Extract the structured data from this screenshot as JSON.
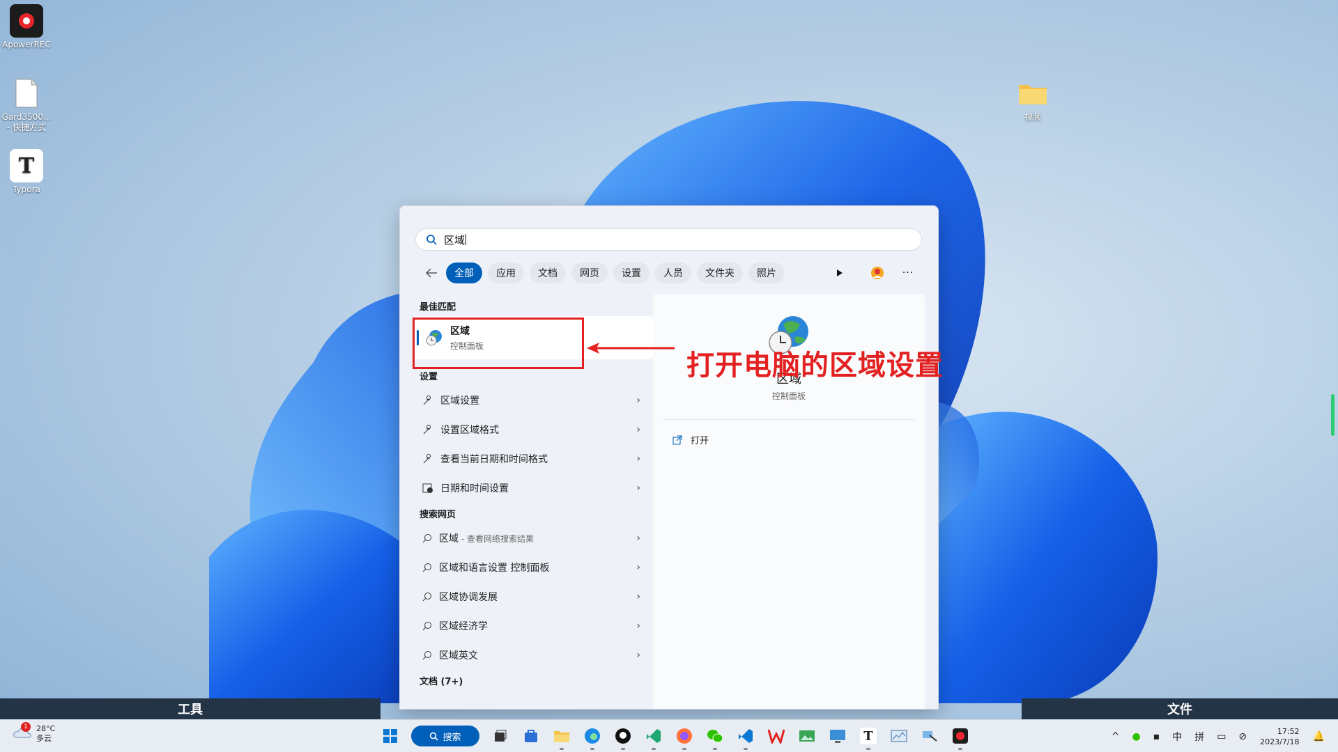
{
  "desktop": {
    "icons": [
      {
        "label": "ApowerREC"
      },
      {
        "label": "Gard3500...\n- 快捷方式"
      },
      {
        "label": "Typora"
      },
      {
        "label": "视频"
      }
    ]
  },
  "side_bars": {
    "left_label": "工具",
    "right_label": "文件"
  },
  "search": {
    "query": "区域",
    "filters": [
      "全部",
      "应用",
      "文档",
      "网页",
      "设置",
      "人员",
      "文件夹",
      "照片"
    ],
    "active_filter": "全部"
  },
  "best_match": {
    "section_title": "最佳匹配",
    "name": "区域",
    "subtitle": "控制面板"
  },
  "settings_section": {
    "title": "设置",
    "items": [
      "区域设置",
      "设置区域格式",
      "查看当前日期和时间格式",
      "日期和时间设置"
    ]
  },
  "web_section": {
    "title": "搜索网页",
    "items": [
      {
        "label": "区域",
        "hint": " - 查看网络搜索结果"
      },
      {
        "label": "区域和语言设置 控制面板",
        "hint": ""
      },
      {
        "label": "区域协调发展",
        "hint": ""
      },
      {
        "label": "区域经济学",
        "hint": ""
      },
      {
        "label": "区域英文",
        "hint": ""
      }
    ]
  },
  "documents_section": {
    "title": "文档 (7+)"
  },
  "detail": {
    "name": "区域",
    "subtitle": "控制面板",
    "open_label": "打开"
  },
  "annotation": {
    "text": "打开电脑的区域设置",
    "color": "#e32121"
  },
  "taskbar": {
    "search_label": "搜索",
    "weather_temp": "28°C",
    "weather_desc": "多云",
    "weather_badge": "1",
    "tray_lang": "中",
    "tray_ime": "拼",
    "time": "17:52",
    "date": "2023/7/18"
  },
  "colors": {
    "accent": "#005fb8",
    "annotation": "#e32121"
  }
}
